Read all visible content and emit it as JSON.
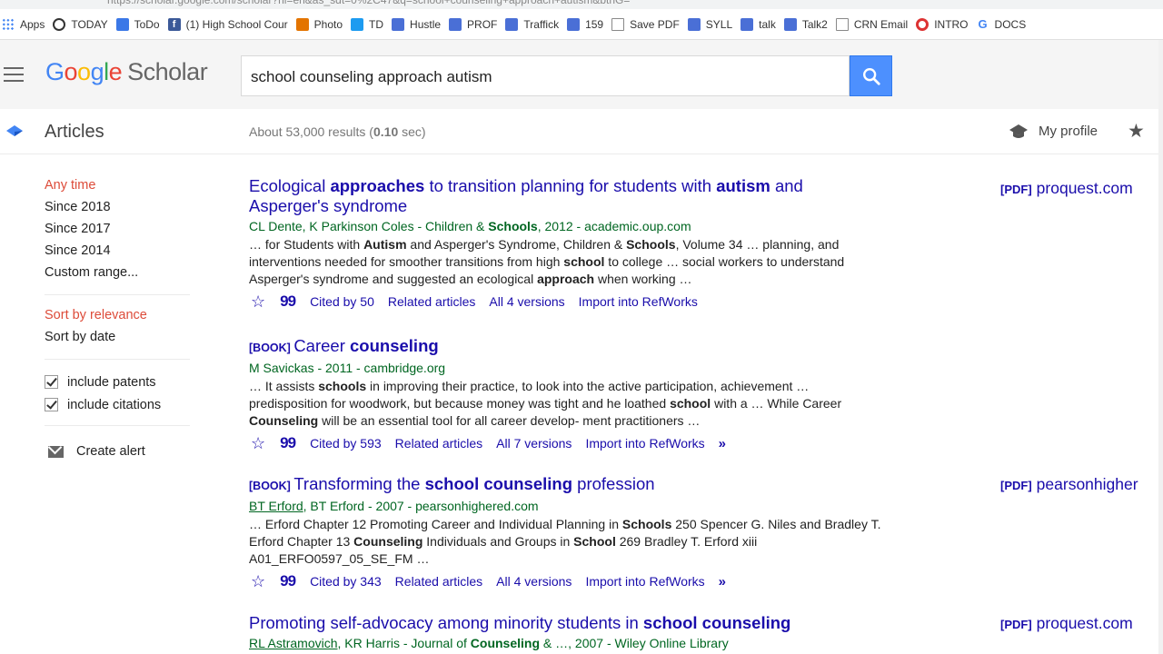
{
  "browser": {
    "bookmarks": [
      {
        "label": "Apps",
        "icon": "apps-grid-icon"
      },
      {
        "label": "TODAY",
        "icon": "today-icon"
      },
      {
        "label": "ToDo",
        "icon": "todo-icon"
      },
      {
        "label": "(1) High School Cour",
        "icon": "facebook-icon"
      },
      {
        "label": "Photo",
        "icon": "photo-icon"
      },
      {
        "label": "TD",
        "icon": "td-icon"
      },
      {
        "label": "Hustle",
        "icon": "doc-icon"
      },
      {
        "label": "PROF",
        "icon": "doc-icon"
      },
      {
        "label": "Traffick",
        "icon": "doc-icon"
      },
      {
        "label": "159",
        "icon": "doc-icon"
      },
      {
        "label": "Save PDF",
        "icon": "page-icon"
      },
      {
        "label": "SYLL",
        "icon": "doc-icon"
      },
      {
        "label": "talk",
        "icon": "doc-icon"
      },
      {
        "label": "Talk2",
        "icon": "doc-icon"
      },
      {
        "label": "CRN Email",
        "icon": "page-icon"
      },
      {
        "label": "INTRO",
        "icon": "intro-icon"
      },
      {
        "label": "DOCS",
        "icon": "google-icon"
      }
    ]
  },
  "header": {
    "logo_scholar": "Scholar",
    "search_value": "school counseling approach autism"
  },
  "subheader": {
    "section": "Articles",
    "stats_prefix": "About 53,000 results (",
    "stats_time": "0.10",
    "stats_suffix": " sec)",
    "my_profile": "My profile"
  },
  "sidebar": {
    "time_filters": [
      "Any time",
      "Since 2018",
      "Since 2017",
      "Since 2014",
      "Custom range..."
    ],
    "sort_options": [
      "Sort by relevance",
      "Sort by date"
    ],
    "include_patents": "include patents",
    "include_citations": "include citations",
    "create_alert": "Create alert"
  },
  "results": [
    {
      "type": "",
      "title_parts": [
        {
          "t": "Ecological ",
          "b": false
        },
        {
          "t": "approaches",
          "b": true
        },
        {
          "t": " to transition planning for students with ",
          "b": false
        },
        {
          "t": "autism",
          "b": true
        },
        {
          "t": " and Asperger's syndrome",
          "b": false
        }
      ],
      "authors": "CL Dente, K Parkinson Coles - Children & ",
      "authors_bold": "Schools",
      "authors_rest": ", 2012 - academic.oup.com",
      "snippet_parts": [
        {
          "t": "… for Students with ",
          "b": false
        },
        {
          "t": "Autism",
          "b": true
        },
        {
          "t": " and Asperger's Syndrome, Children & ",
          "b": false
        },
        {
          "t": "Schools",
          "b": true
        },
        {
          "t": ", Volume 34 … planning, and interventions needed for smoother transitions from high ",
          "b": false
        },
        {
          "t": "school",
          "b": true
        },
        {
          "t": " to college … social workers to understand Asperger's syndrome and suggested an ecological ",
          "b": false
        },
        {
          "t": "approach",
          "b": true
        },
        {
          "t": " when working …",
          "b": false
        }
      ],
      "cited": "Cited by 50",
      "related": "Related articles",
      "versions": "All 4 versions",
      "import": "Import into RefWorks",
      "side_tag": "[PDF]",
      "side_source": "proquest.com"
    },
    {
      "type": "[BOOK]",
      "title_parts": [
        {
          "t": "Career ",
          "b": false
        },
        {
          "t": "counseling",
          "b": true
        }
      ],
      "authors": "M Savickas - 2011 - cambridge.org",
      "authors_bold": "",
      "authors_rest": "",
      "snippet_parts": [
        {
          "t": "… It assists ",
          "b": false
        },
        {
          "t": "schools",
          "b": true
        },
        {
          "t": " in improving their practice, to look into the active participation, achievement … predisposition for woodwork, but because money was tight and he loathed ",
          "b": false
        },
        {
          "t": "school",
          "b": true
        },
        {
          "t": " with a … While Career ",
          "b": false
        },
        {
          "t": "Counseling",
          "b": true
        },
        {
          "t": " will be an essential tool for all career develop- ment practitioners …",
          "b": false
        }
      ],
      "cited": "Cited by 593",
      "related": "Related articles",
      "versions": "All 7 versions",
      "import": "Import into RefWorks",
      "side_tag": "",
      "side_source": ""
    },
    {
      "type": "[BOOK]",
      "title_parts": [
        {
          "t": "Transforming the ",
          "b": false
        },
        {
          "t": "school counseling",
          "b": true
        },
        {
          "t": " profession",
          "b": false
        }
      ],
      "authors_link": "BT Erford",
      "authors": ", BT Erford - 2007 - pearsonhighered.com",
      "authors_bold": "",
      "authors_rest": "",
      "snippet_parts": [
        {
          "t": "… Erford Chapter 12 Promoting Career and Individual Planning in ",
          "b": false
        },
        {
          "t": "Schools",
          "b": true
        },
        {
          "t": " 250 Spencer G. Niles and Bradley T. Erford Chapter 13 ",
          "b": false
        },
        {
          "t": "Counseling",
          "b": true
        },
        {
          "t": " Individuals and Groups in ",
          "b": false
        },
        {
          "t": "School",
          "b": true
        },
        {
          "t": " 269 Bradley T. Erford xiii A01_ERFO0597_05_SE_FM …",
          "b": false
        }
      ],
      "cited": "Cited by 343",
      "related": "Related articles",
      "versions": "All 4 versions",
      "import": "Import into RefWorks",
      "side_tag": "[PDF]",
      "side_source": "pearsonhigher"
    },
    {
      "type": "",
      "title_parts": [
        {
          "t": "Promoting self-advocacy among minority students in ",
          "b": false
        },
        {
          "t": "school counseling",
          "b": true
        }
      ],
      "authors_link": "RL Astramovich",
      "authors": ", KR Harris - Journal of ",
      "authors_bold": "Counseling",
      "authors_rest": " & …, 2007 - Wiley Online Library",
      "side_tag": "[PDF]",
      "side_source": "proquest.com"
    }
  ]
}
